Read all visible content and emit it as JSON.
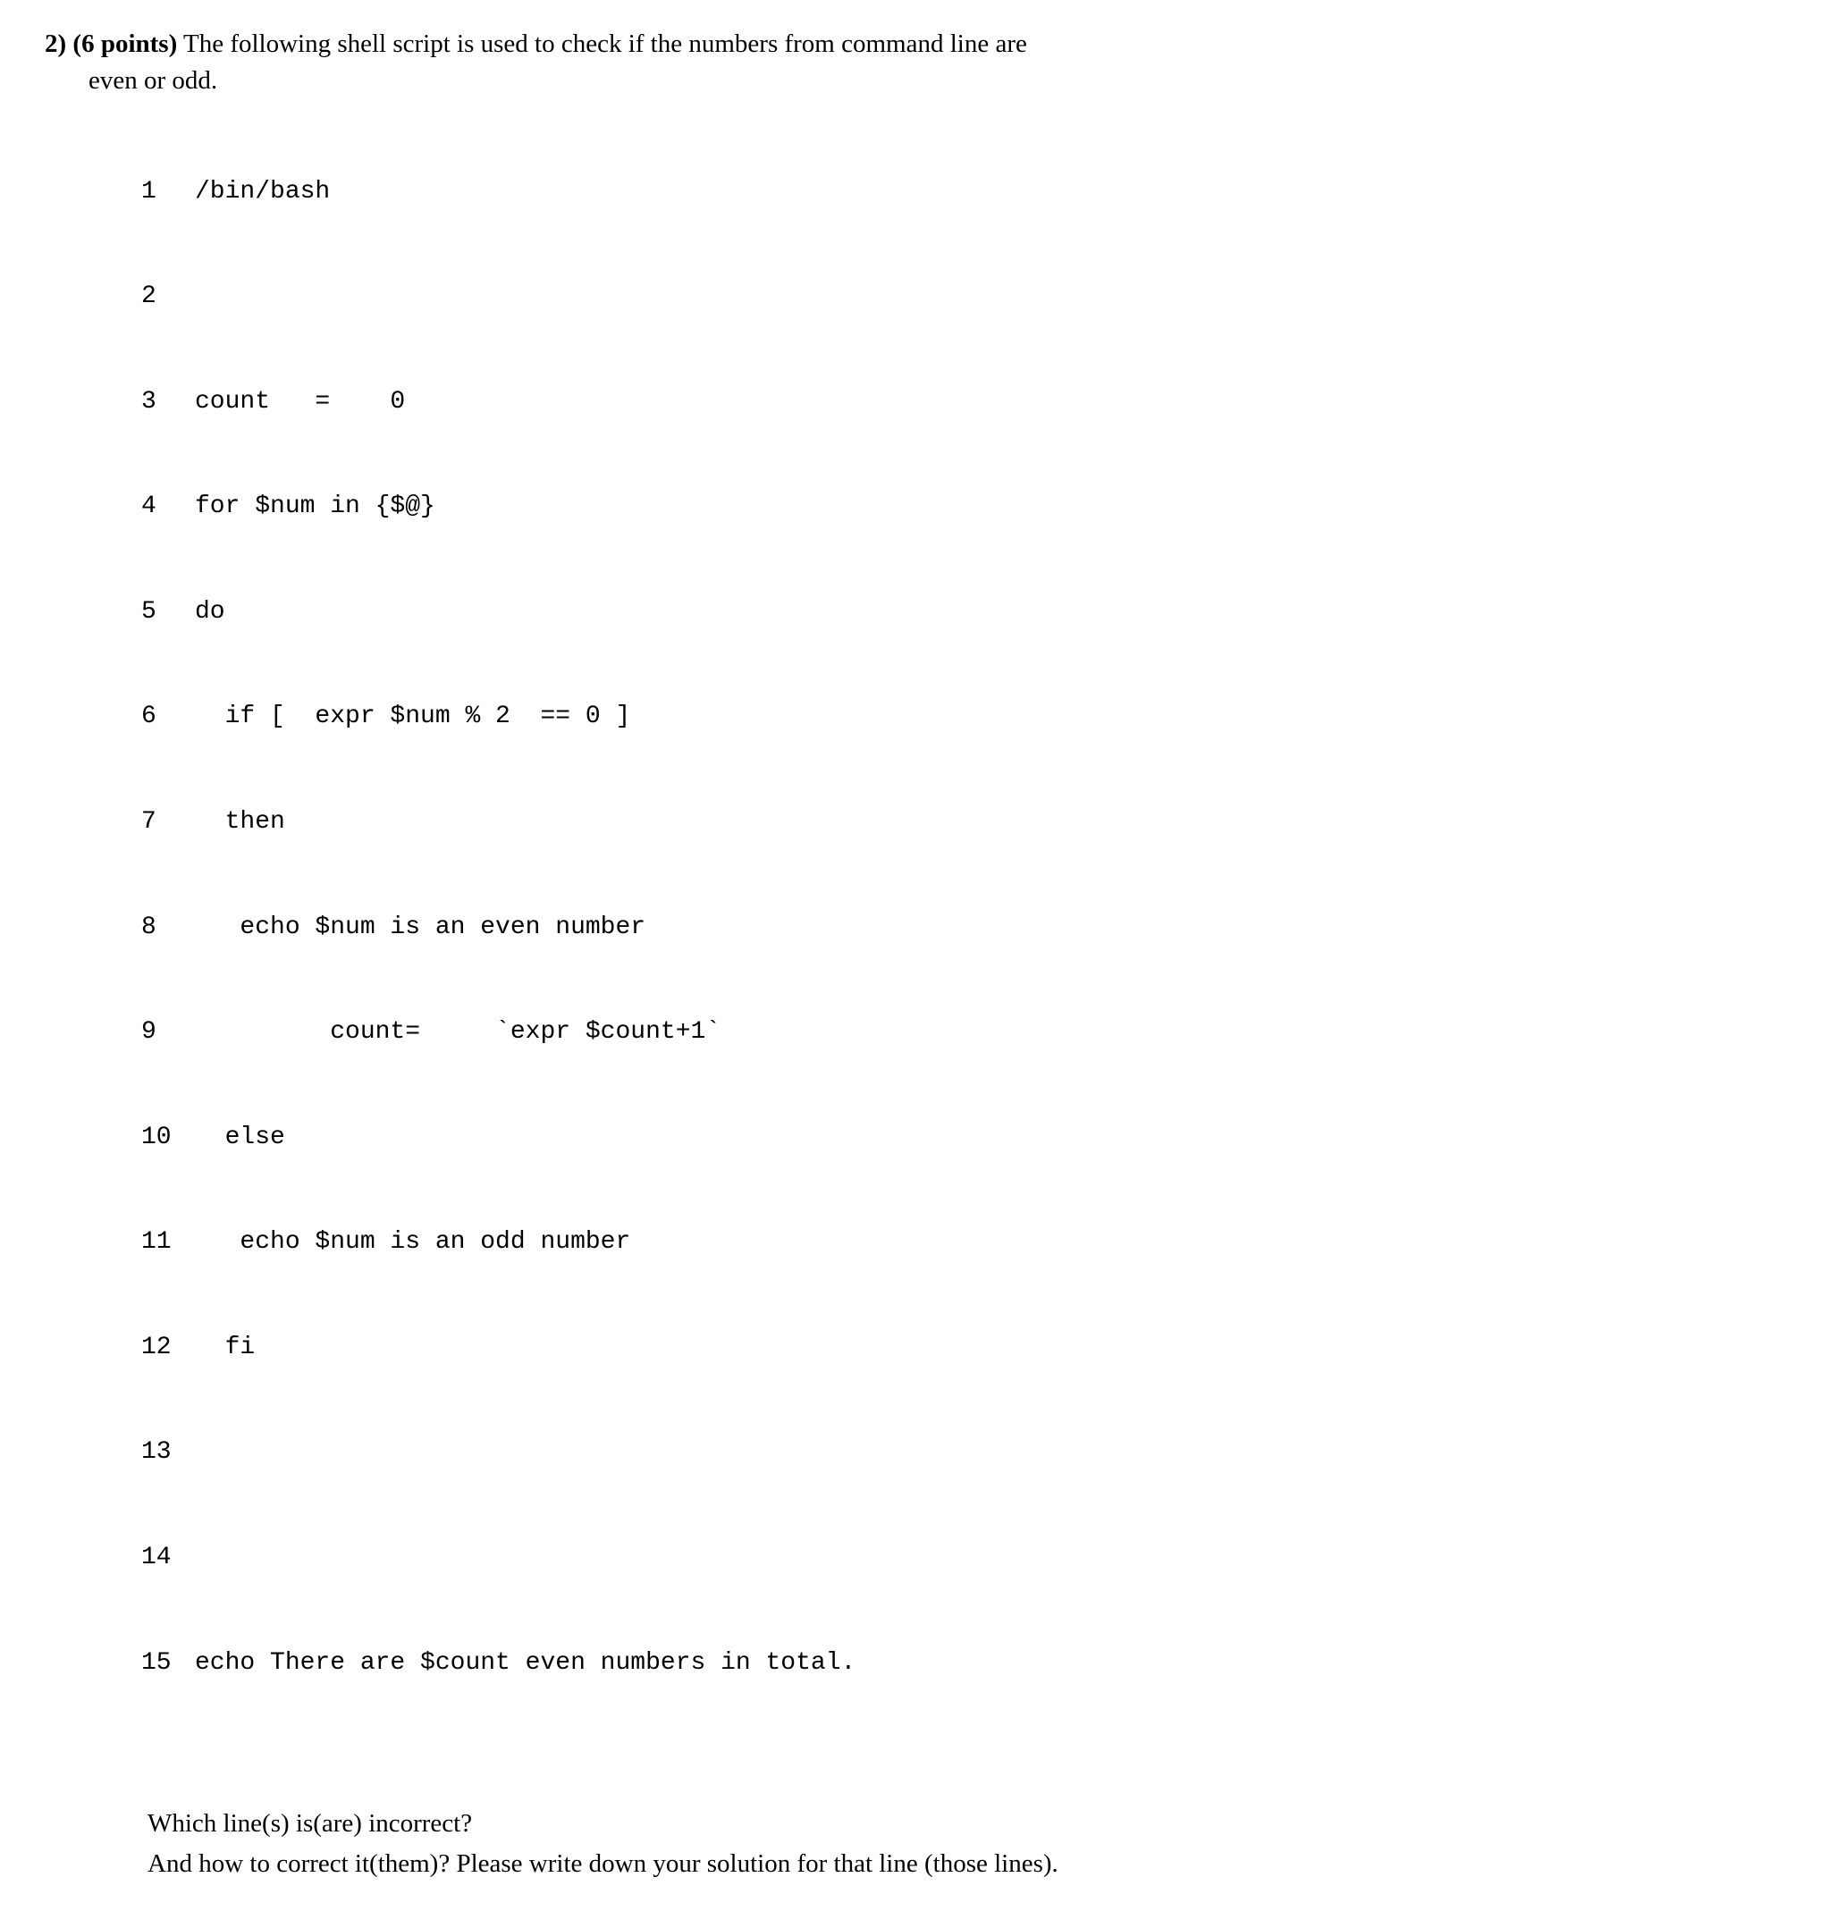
{
  "question": {
    "number": "2)",
    "points": "(6 points)",
    "prompt_part1": "The following shell script is used to check if the numbers from command line are",
    "prompt_part2": "even or odd."
  },
  "code": {
    "lines": [
      {
        "n": "1",
        "t": "/bin/bash"
      },
      {
        "n": "2",
        "t": ""
      },
      {
        "n": "3",
        "t": "count   =    0"
      },
      {
        "n": "4",
        "t": "for $num in {$@}"
      },
      {
        "n": "5",
        "t": "do"
      },
      {
        "n": "6",
        "t": "  if [  expr $num % 2  == 0 ]"
      },
      {
        "n": "7",
        "t": "  then"
      },
      {
        "n": "8",
        "t": "   echo $num is an even number"
      },
      {
        "n": "9",
        "t": "         count=     `expr $count+1`"
      },
      {
        "n": "10",
        "t": "  else"
      },
      {
        "n": "11",
        "t": "   echo $num is an odd number"
      },
      {
        "n": "12",
        "t": "  fi"
      },
      {
        "n": "13",
        "t": ""
      },
      {
        "n": "14",
        "t": ""
      },
      {
        "n": "15",
        "t": "echo There are $count even numbers in total."
      }
    ]
  },
  "followup": {
    "q1": "Which line(s) is(are) incorrect?",
    "q2": "And how to correct it(them)? Please write down your solution for that line (those lines)."
  }
}
